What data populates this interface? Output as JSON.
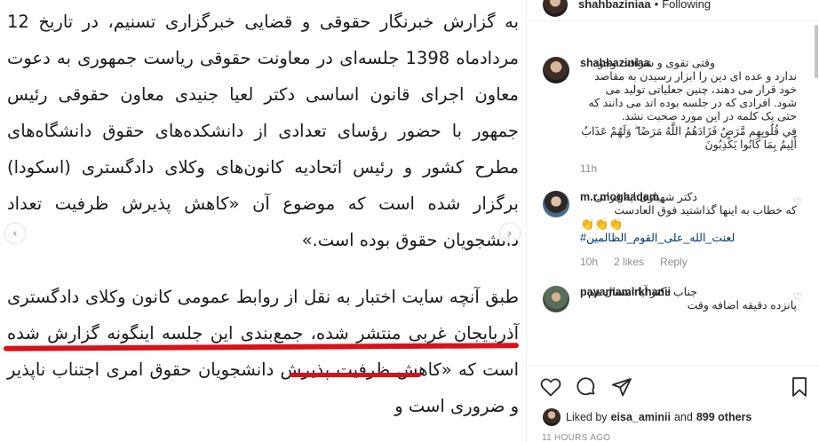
{
  "photo": {
    "paragraph1": "به گزارش خبرنگار حقوقی و قضایی خبرگزاری تسنیم، در تاریخ 12 مردادماه 1398 جلسه‌ای در معاونت حقوقی ریاست جمهوری به دعوت معاون اجرای قانون اساسی دکتر لعیا جنیدی معاون حقوقی رئیس جمهور با حضور رؤسای تعدادی از دانشکده‌های حقوق دانشگاه‌های مطرح کشور و رئیس اتحادیه کانون‌های وکلای دادگستری (اسکودا) برگزار شده است که موضوع آن «کاهش پذیرش ظرفیت تعداد دانشجویان حقوق بوده است.»",
    "paragraph2": "طبق آنچه سایت اختبار به نقل از روابط عمومی کانون وکلای دادگستری آذربایجان غربی منتشر شده، جمع‌بندی این جلسه اینگونه گزارش شده است که «کاهش ظرفیت پذیرش دانشجویان حقوق امری اجتناب ناپذیر و ضروری است و",
    "underline_color": "#d8121a"
  },
  "header": {
    "username": "shahbaziniaa",
    "separator": "•",
    "follow_label": "Following"
  },
  "comments": [
    {
      "username": "shahbaziniaa",
      "text": "وقتی تقوی و شرافت وجود ندارد و عده ای دین را ابزار رسیدن به مقاصد خود قرار می دهند، چنین جعلیاتی تولید می شود. افرادی که در جلسه بوده اند می دانند که حتی یک کلمه در این مورد صحبت نشد.",
      "verse": "فِي قُلُوبِهِم مَّرَضٌ فَزَادَهُمُ اللَّهُ مَرَضًا ۖ وَلَهُمْ عَذَابٌ أَلِيمٌ بِمَا كَانُوا يَكْذِبُونَ",
      "time": "11h"
    },
    {
      "username": "m.r.moghadam_",
      "text": "دکتر شهبازی ایه قرانی که خطاب به اینها گذاشتید فوق العادست",
      "emoji": "👏👏👏",
      "hashtag": "#لعنت_الله_علی_القوم_الظالمین",
      "time": "10h",
      "likes": "2 likes",
      "reply": "Reply"
    },
    {
      "username": "payamamirkhanii",
      "text": "جناب دکتر آیا امسال هم پانزده دقیقه اضافه وقت"
    }
  ],
  "likes": {
    "prefix": "Liked by",
    "user": "eisa_aminii",
    "and": "and",
    "others": "899 others"
  },
  "timestamp": "11 HOURS AGO",
  "colors": {
    "text_primary": "#262626",
    "text_secondary": "#8e8e8e",
    "hashtag": "#00376b"
  }
}
